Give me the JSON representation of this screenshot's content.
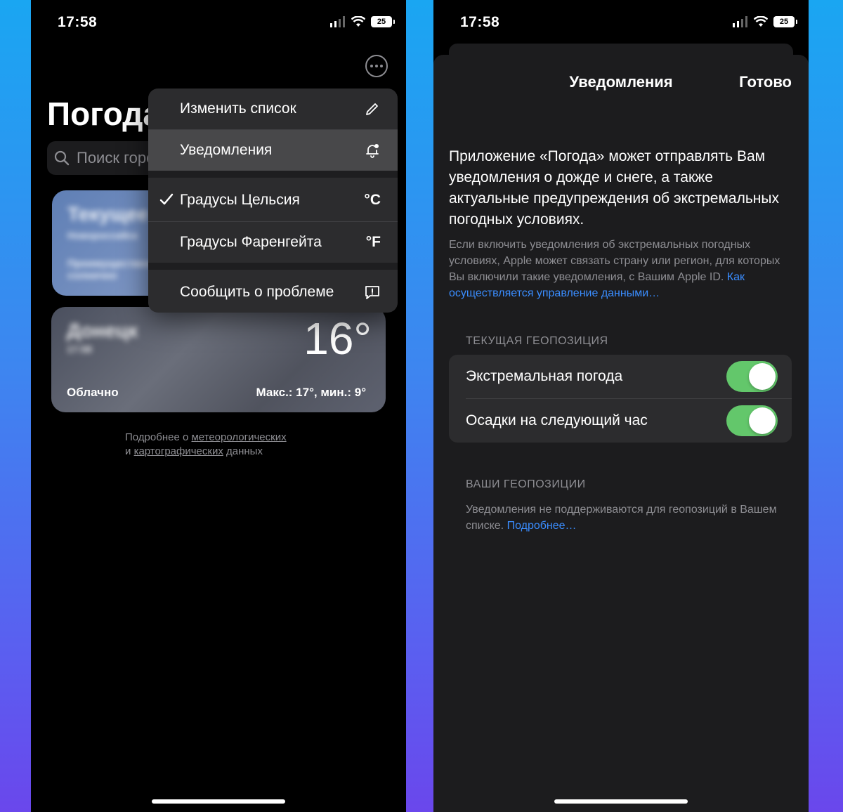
{
  "status_bar": {
    "time": "17:58",
    "battery": "25"
  },
  "left_screen": {
    "title": "Погода",
    "search_placeholder": "Поиск города",
    "current_card": {
      "title": "Текущее",
      "subtitle": "Новороссийск",
      "note": "Преимущественно солнечно"
    },
    "city_card": {
      "city": "Донецк",
      "time": "17:58",
      "temperature": "16°",
      "condition": "Облачно",
      "range": "Макс.: 17°, мин.: 9°"
    },
    "footer": {
      "prefix": "Подробнее о",
      "link1": "метеорологических",
      "conj": "и",
      "link2": "картографических",
      "suffix": "данных"
    },
    "menu": {
      "edit_list": "Изменить список",
      "notifications": "Уведомления",
      "celsius": "Градусы Цельсия",
      "celsius_unit": "°C",
      "fahrenheit": "Градусы Фаренгейта",
      "fahrenheit_unit": "°F",
      "report": "Сообщить о проблеме"
    }
  },
  "right_screen": {
    "title": "Уведомления",
    "done": "Готово",
    "intro": "Приложение «Погода» может отправлять Вам уведомления о дожде и снеге, а также актуальные предупреждения об экстремальных погодных условиях.",
    "detail": "Если включить уведомления об экстремальных погодных условиях, Apple может связать страну или регион, для которых Вы включили такие уведомления, с Вашим Apple ID.",
    "detail_link": "Как осуществляется управление данными…",
    "current_location_header": "ТЕКУЩАЯ ГЕОПОЗИЦИЯ",
    "extreme_weather": "Экстремальная погода",
    "precipitation": "Осадки на следующий час",
    "your_locations_header": "ВАШИ ГЕОПОЗИЦИИ",
    "locations_note": "Уведомления не поддерживаются для геопозиций в Вашем списке.",
    "locations_link": "Подробнее…"
  },
  "colors": {
    "toggle_on": "#63c76b",
    "link": "#3a8dff",
    "menu_bg": "#2c2c2e",
    "sheet_bg": "#1c1c1e"
  },
  "icons": [
    "signal-icon",
    "wifi-icon",
    "battery-icon",
    "more-icon",
    "search-icon",
    "pencil-icon",
    "bell-icon",
    "checkmark-icon",
    "report-icon"
  ]
}
